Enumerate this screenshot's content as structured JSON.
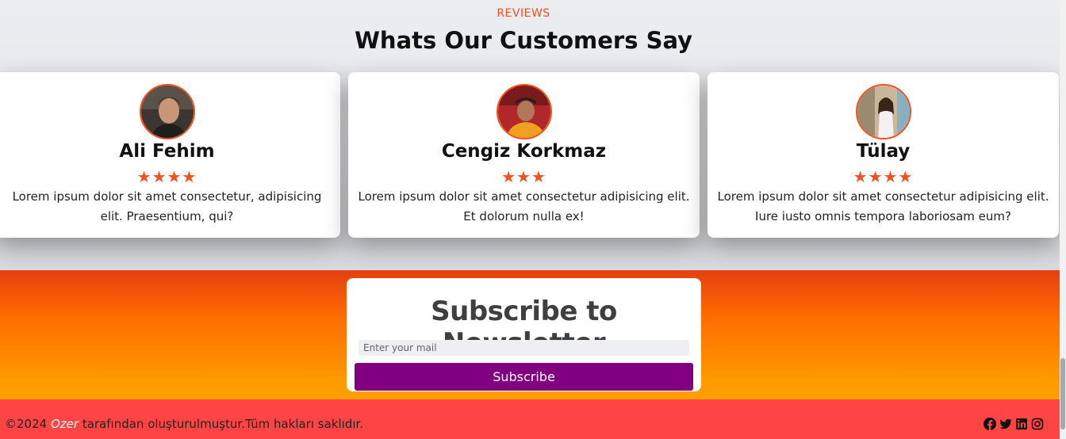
{
  "reviews": {
    "label": "REVIEWS",
    "title": "Whats Our Customers Say",
    "cards": [
      {
        "name": "Ali Fehim",
        "rating": 4,
        "stars": "★★★★",
        "text": "Lorem ipsum dolor sit amet consectetur, adipisicing elit. Praesentium, qui?"
      },
      {
        "name": "Cengiz Korkmaz",
        "rating": 3,
        "stars": "★★★",
        "text": "Lorem ipsum dolor sit amet consectetur adipisicing elit. Et dolorum nulla ex!"
      },
      {
        "name": "Tülay",
        "rating": 4,
        "stars": "★★★★",
        "text": "Lorem ipsum dolor sit amet consectetur adipisicing elit. Iure iusto omnis tempora laboriosam eum?"
      }
    ]
  },
  "newsletter": {
    "title": "Subscribe to Newsletter",
    "placeholder": "Enter your mail",
    "button_label": "Subscribe"
  },
  "footer": {
    "copyright": "©2024",
    "author": "Ozer",
    "rest": " tarafından oluşturulmuştur.Tüm hakları saklıdır.",
    "social_icons": [
      "facebook-icon",
      "twitter-icon",
      "linkedin-icon",
      "instagram-icon"
    ]
  },
  "colors": {
    "accent": "#f2501e",
    "button": "#800080",
    "footer": "#ff4444"
  }
}
